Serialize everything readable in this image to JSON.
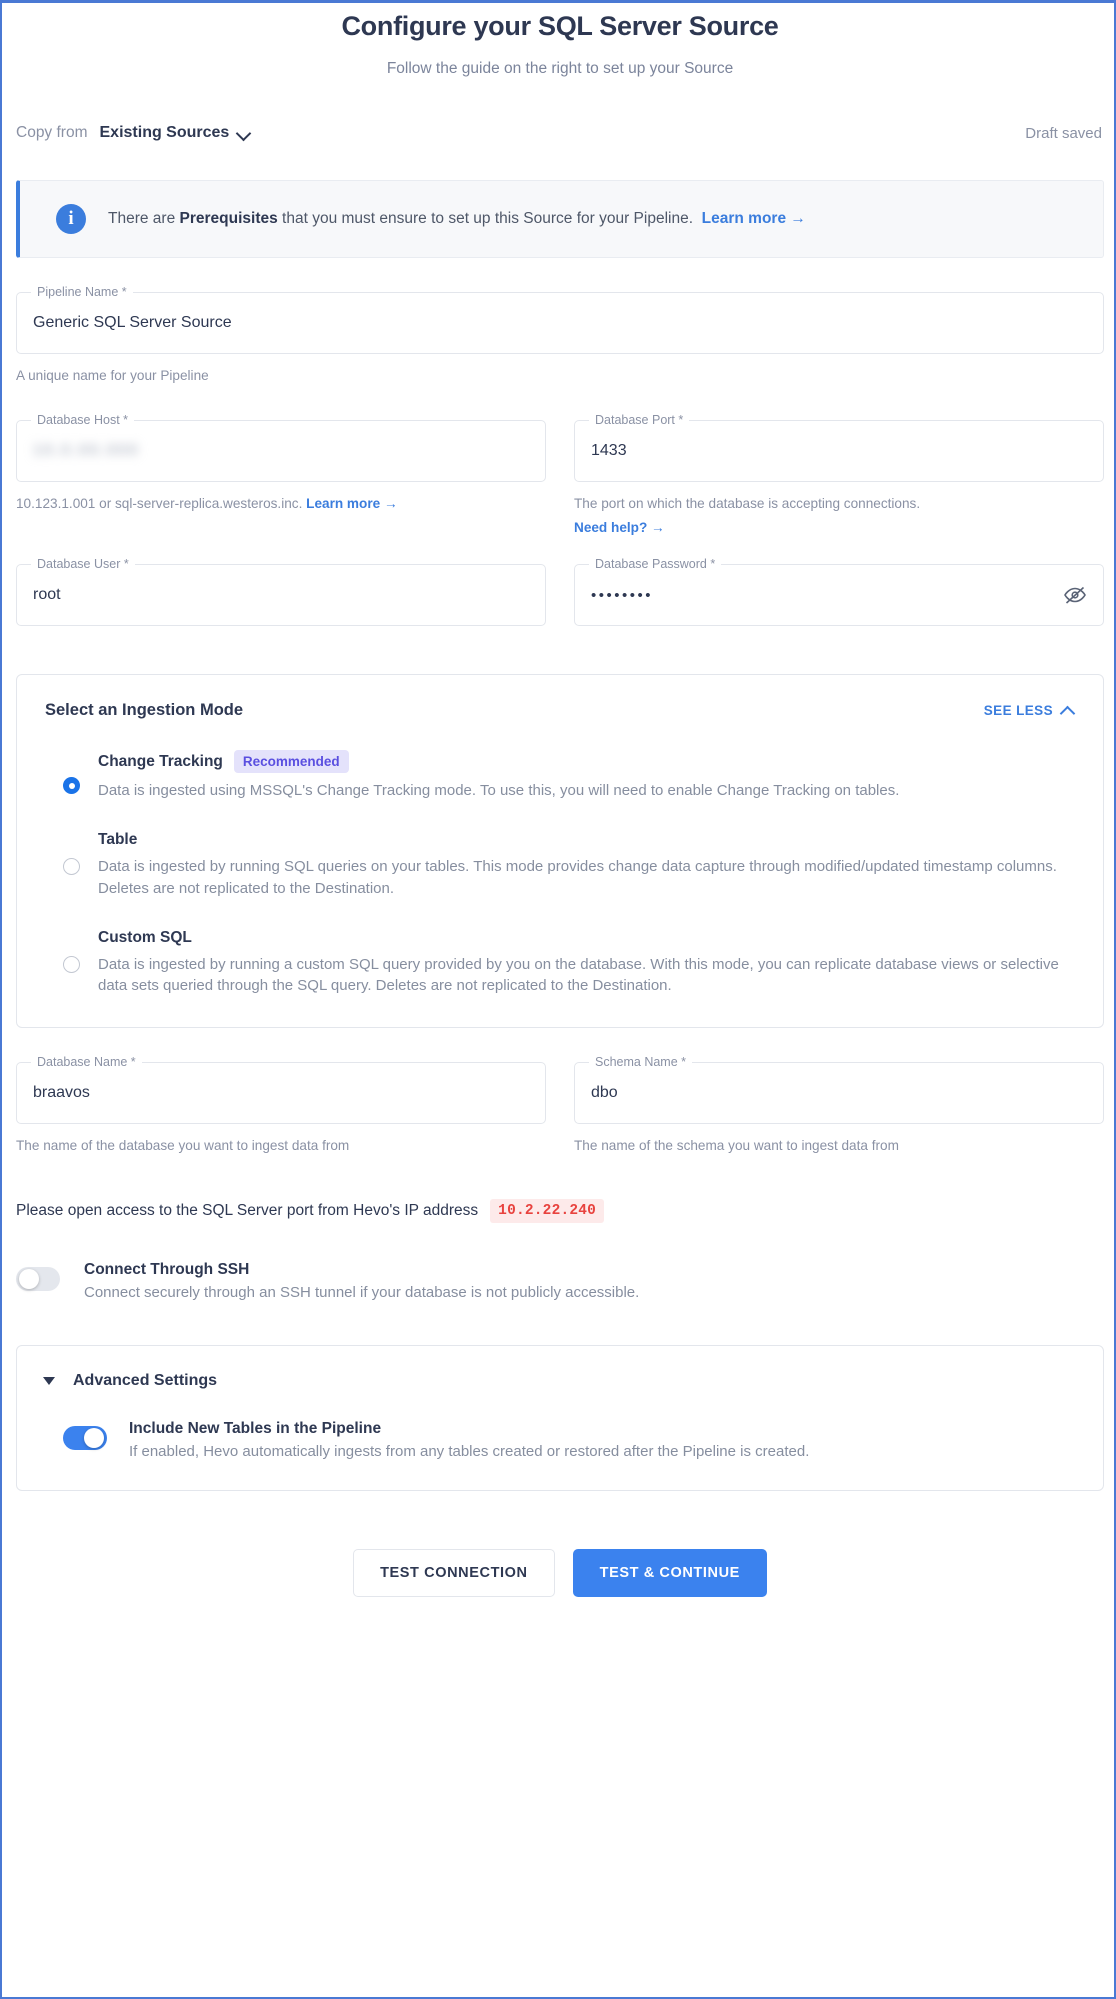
{
  "header": {
    "title": "Configure your SQL Server Source",
    "subtitle": "Follow the guide on the right to set up your Source"
  },
  "copy_from": {
    "label": "Copy from",
    "selected": "Existing Sources",
    "chevron_icon": "chevron-down-icon",
    "draft_status": "Draft saved"
  },
  "banner": {
    "icon": "info-icon",
    "text_before": "There are ",
    "bold": "Prerequisites",
    "text_after": " that you must ensure to set up this Source for your Pipeline.",
    "link": "Learn more",
    "arrow": "→"
  },
  "fields": {
    "pipeline_name": {
      "label": "Pipeline Name *",
      "value": "Generic SQL Server Source",
      "hint": "A unique name for your Pipeline"
    },
    "database_host": {
      "label": "Database Host *",
      "value": "10.0.00.000",
      "hint": "10.123.1.001 or sql-server-replica.westeros.inc.",
      "hint_link": "Learn more",
      "arrow": "→"
    },
    "database_port": {
      "label": "Database Port *",
      "value": "1433",
      "hint": "The port on which the database is accepting connections.",
      "hint_link": "Need help?",
      "arrow": "→"
    },
    "database_user": {
      "label": "Database User *",
      "value": "root"
    },
    "database_password": {
      "label": "Database Password *",
      "value": "••••••••",
      "toggle_icon": "eye-off-icon"
    },
    "database_name": {
      "label": "Database Name *",
      "value": "braavos",
      "hint": "The name of the database you want to ingest data from"
    },
    "schema_name": {
      "label": "Schema Name *",
      "value": "dbo",
      "hint": "The name of the schema you want to ingest data from"
    }
  },
  "ingestion": {
    "title": "Select an Ingestion Mode",
    "see_less": "SEE LESS",
    "see_less_icon": "chevron-up-icon",
    "options": [
      {
        "title": "Change Tracking",
        "badge": "Recommended",
        "description": "Data is ingested using MSSQL's Change Tracking mode. To use this, you will need to enable Change Tracking on tables.",
        "selected": true
      },
      {
        "title": "Table",
        "badge": "",
        "description": "Data is ingested by running SQL queries on your tables. This mode provides change data capture through modified/updated timestamp columns. Deletes are not replicated to the Destination.",
        "selected": false
      },
      {
        "title": "Custom SQL",
        "badge": "",
        "description": "Data is ingested by running a custom SQL query provided by you on the database. With this mode, you can replicate database views or selective data sets queried through the SQL query. Deletes are not replicated to the Destination.",
        "selected": false
      }
    ]
  },
  "ip_notice": {
    "text": "Please open access to the SQL Server port from Hevo's IP address",
    "ip": "10.2.22.240"
  },
  "ssh": {
    "title": "Connect Through SSH",
    "description": "Connect securely through an SSH tunnel if your database is not publicly accessible.",
    "enabled": false
  },
  "advanced": {
    "title": "Advanced Settings",
    "caret_icon": "caret-down-icon",
    "include_new_tables": {
      "title": "Include New Tables in the Pipeline",
      "description": "If enabled, Hevo automatically ingests from any tables created or restored after the Pipeline is created.",
      "enabled": true
    }
  },
  "actions": {
    "test_connection": "TEST CONNECTION",
    "test_and_continue": "TEST & CONTINUE"
  },
  "colors": {
    "accent": "#3b7ddd",
    "primary_button": "#3b82ee",
    "badge_bg": "#e4e2fb",
    "badge_text": "#5a4fe0",
    "ip_chip_text": "#e8433f"
  }
}
